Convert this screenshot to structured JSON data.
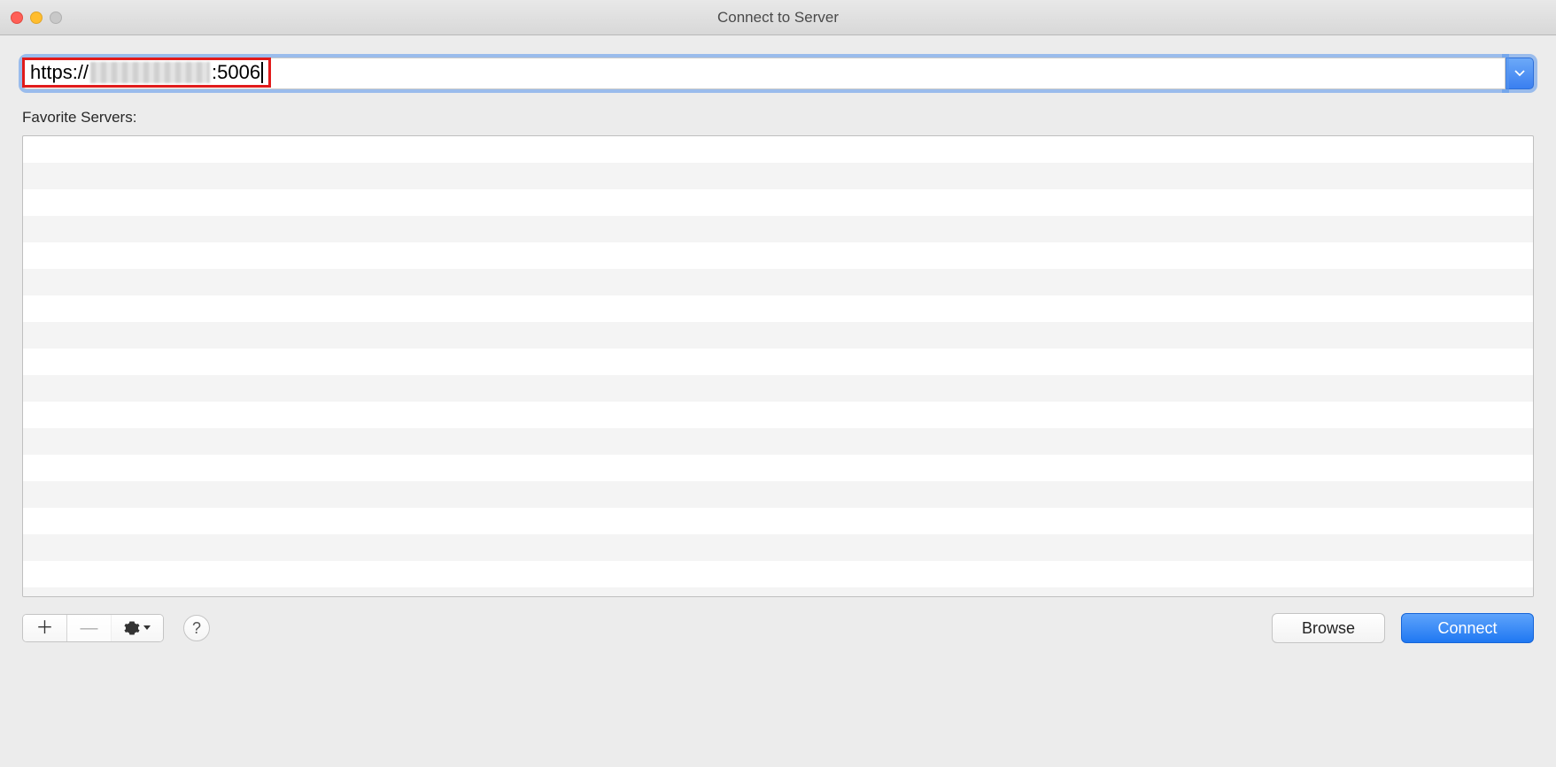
{
  "window": {
    "title": "Connect to Server"
  },
  "address": {
    "prefix": "https://",
    "suffix": ":5006"
  },
  "favorites": {
    "label": "Favorite Servers:"
  },
  "buttons": {
    "browse": "Browse",
    "connect": "Connect",
    "help": "?"
  }
}
